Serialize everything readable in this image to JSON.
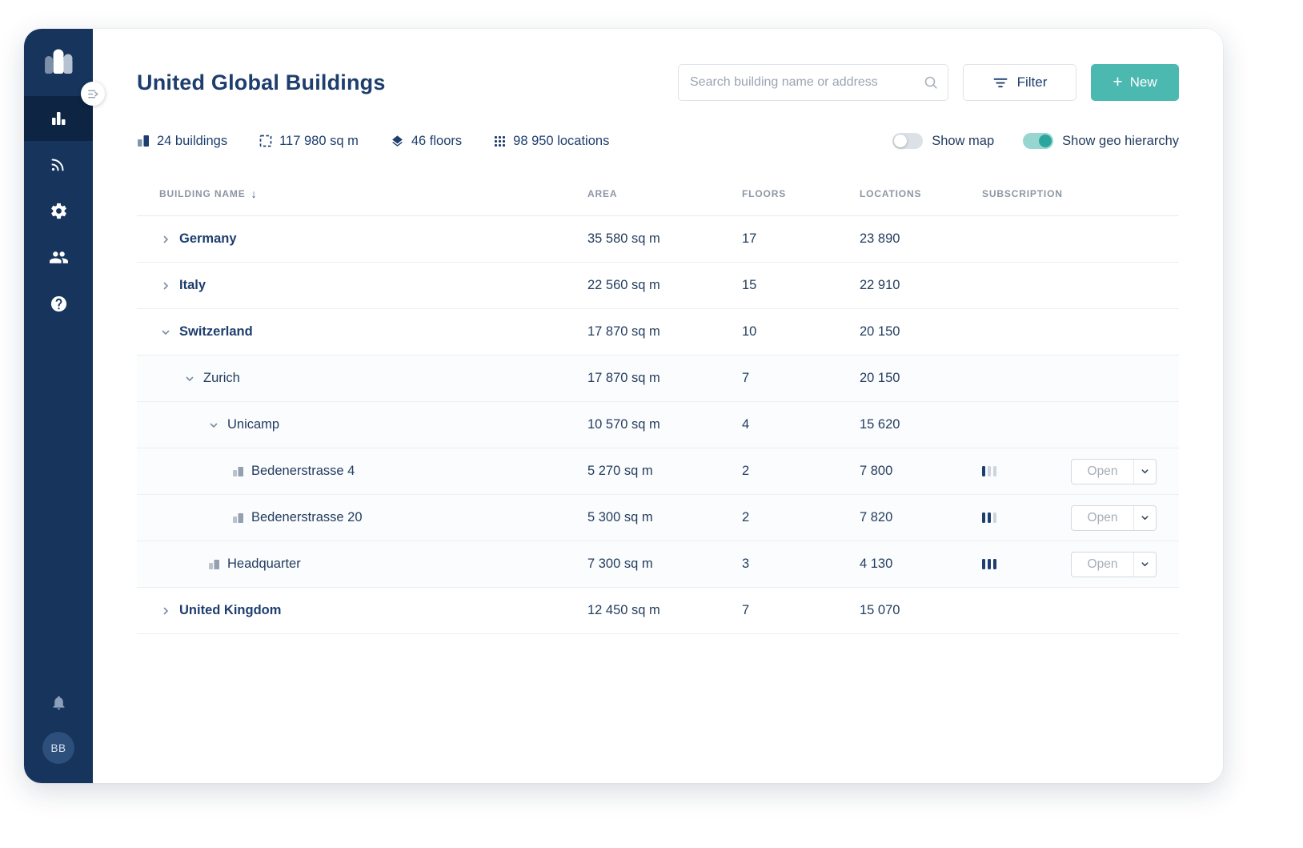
{
  "header": {
    "title": "United Global Buildings",
    "search": {
      "placeholder": "Search building name or address",
      "value": ""
    },
    "filter_label": "Filter",
    "new_label": "New"
  },
  "sidebar": {
    "nav": [
      {
        "icon": "buildings-icon",
        "active": true
      },
      {
        "icon": "sensor-icon",
        "active": false
      },
      {
        "icon": "settings-gear-icon",
        "active": false
      },
      {
        "icon": "users-icon",
        "active": false
      },
      {
        "icon": "help-icon",
        "active": false
      }
    ],
    "avatar_initials": "BB"
  },
  "stats": [
    {
      "icon": "buildings-count-icon",
      "label": "24 buildings"
    },
    {
      "icon": "area-icon",
      "label": "117 980 sq m"
    },
    {
      "icon": "floors-icon",
      "label": "46 floors"
    },
    {
      "icon": "locations-icon",
      "label": "98 950 locations"
    }
  ],
  "toggles": {
    "show_map": {
      "label": "Show map",
      "on": false
    },
    "show_geo_hierarchy": {
      "label": "Show geo hierarchy",
      "on": true
    }
  },
  "table": {
    "columns": [
      "Building name",
      "Area",
      "Floors",
      "Locations",
      "Subscription"
    ],
    "sort": {
      "column": "Building name",
      "direction": "desc"
    },
    "rows": [
      {
        "name": "Germany",
        "level": 0,
        "kind": "country",
        "expanded": false,
        "area": "35 580 sq m",
        "floors": "17",
        "locations": "23 890",
        "subscription": null,
        "action": null
      },
      {
        "name": "Italy",
        "level": 0,
        "kind": "country",
        "expanded": false,
        "area": "22 560 sq m",
        "floors": "15",
        "locations": "22 910",
        "subscription": null,
        "action": null
      },
      {
        "name": "Switzerland",
        "level": 0,
        "kind": "country",
        "expanded": true,
        "area": "17 870 sq m",
        "floors": "10",
        "locations": "20 150",
        "subscription": null,
        "action": null
      },
      {
        "name": "Zurich",
        "level": 1,
        "kind": "region",
        "expanded": true,
        "area": "17 870 sq m",
        "floors": "7",
        "locations": "20 150",
        "subscription": null,
        "action": null
      },
      {
        "name": "Unicamp",
        "level": 2,
        "kind": "campus",
        "expanded": true,
        "area": "10 570 sq m",
        "floors": "4",
        "locations": "15 620",
        "subscription": null,
        "action": null
      },
      {
        "name": "Bedenerstrasse 4",
        "level": 3,
        "kind": "building",
        "expanded": null,
        "area": "5 270 sq m",
        "floors": "2",
        "locations": "7 800",
        "subscription": 1,
        "action": "Open"
      },
      {
        "name": "Bedenerstrasse 20",
        "level": 3,
        "kind": "building",
        "expanded": null,
        "area": "5 300 sq m",
        "floors": "2",
        "locations": "7 820",
        "subscription": 2,
        "action": "Open"
      },
      {
        "name": "Headquarter",
        "level": 2,
        "kind": "building",
        "expanded": null,
        "area": "7 300 sq m",
        "floors": "3",
        "locations": "4 130",
        "subscription": 3,
        "action": "Open"
      },
      {
        "name": "United Kingdom",
        "level": 0,
        "kind": "country",
        "expanded": false,
        "area": "12 450 sq m",
        "floors": "7",
        "locations": "15 070",
        "subscription": null,
        "action": null
      }
    ]
  },
  "colors": {
    "sidebar_navy": "#16345c",
    "text_navy": "#1d3e6e",
    "accent_teal": "#4cb9b1",
    "bar_filled": "#1d3e6e",
    "bar_empty": "#ccd4dd"
  }
}
